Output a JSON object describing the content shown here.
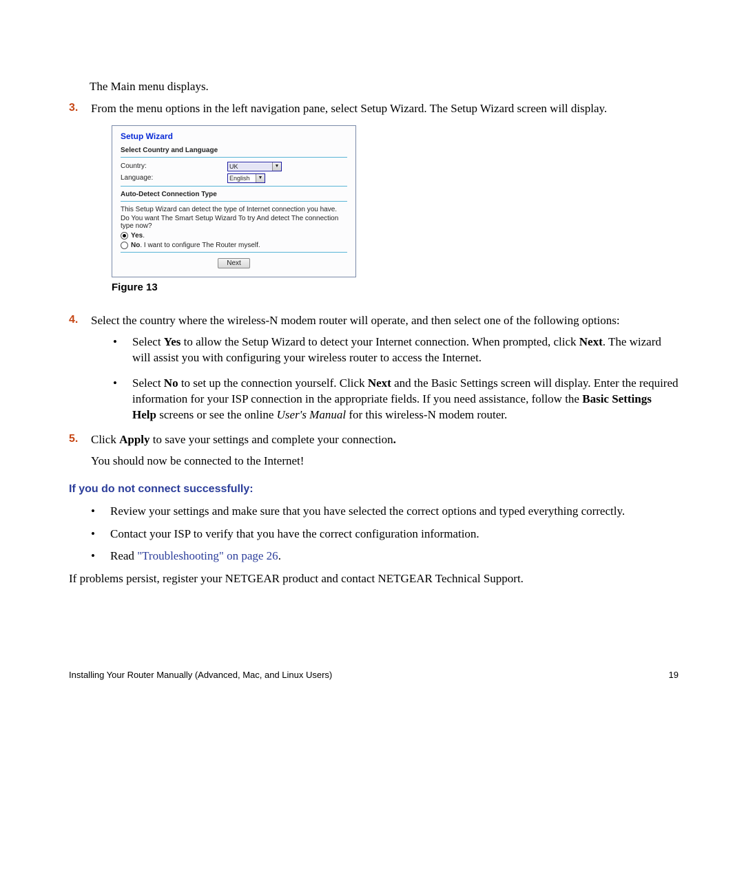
{
  "intro_line": "The Main menu displays.",
  "steps": {
    "s3": {
      "num": "3.",
      "text": "From the menu options in the left navigation pane, select Setup Wizard. The Setup Wizard screen will display."
    },
    "s4": {
      "num": "4.",
      "lead": "Select the country where the wireless-N modem router will operate, and then select one of the following options:",
      "bullet_yes_a": "Select ",
      "bullet_yes_b": "Yes",
      "bullet_yes_c": " to allow the Setup Wizard to detect your Internet connection. When prompted, click ",
      "bullet_yes_d": "Next",
      "bullet_yes_e": ". The wizard will assist you with configuring your wireless router to access the Internet.",
      "bullet_no_a": "Select ",
      "bullet_no_b": "No",
      "bullet_no_c": " to set up the connection yourself. Click ",
      "bullet_no_d": "Next",
      "bullet_no_e": " and the Basic Settings screen will display. Enter the required information for your ISP connection in the appropriate fields. If you need assistance, follow the ",
      "bullet_no_f": "Basic Settings Help",
      "bullet_no_g": " screens or see the online ",
      "bullet_no_h": "User's Manual",
      "bullet_no_i": " for this wireless-N modem router."
    },
    "s5": {
      "num": "5.",
      "text_a": "Click ",
      "text_b": "Apply",
      "text_c": " to save your settings and complete your connection",
      "text_d": ".",
      "after": "You should now be connected to the Internet!"
    }
  },
  "figure_caption": "Figure 13",
  "heading_fail": "If you do not connect successfully:",
  "fail_bullets": {
    "b1": "Review your settings and make sure that you have selected the correct options and typed everything correctly.",
    "b2": "Contact your ISP to verify that you have the correct configuration information.",
    "b3_a": "Read ",
    "b3_link": "\"Troubleshooting\" on page 26",
    "b3_b": "."
  },
  "closing": "If problems persist, register your NETGEAR product and contact NETGEAR Technical Support.",
  "footer_left": "Installing Your Router Manually (Advanced, Mac, and Linux Users)",
  "footer_right": "19",
  "wizard": {
    "title": "Setup Wizard",
    "section1": "Select Country and Language",
    "country_label": "Country:",
    "country_value": "UK",
    "language_label": "Language:",
    "language_value": "English",
    "section2": "Auto-Detect Connection Type",
    "line1": "This Setup Wizard can detect the type of Internet connection you have.",
    "line2": "Do You want The Smart Setup Wizard To try And detect The connection type now?",
    "opt_yes_b": "Yes",
    "opt_yes_rest": ".",
    "opt_no_b": "No",
    "opt_no_rest": ". I want to configure The Router myself.",
    "next": "Next"
  }
}
